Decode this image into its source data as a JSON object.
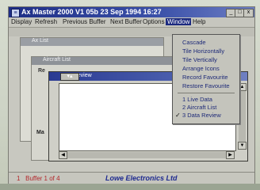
{
  "window": {
    "title": "Ax Master 2000 V1 05b 23 Sep 1994 16:27",
    "controls": [
      "_",
      "□",
      "x"
    ]
  },
  "menubar": {
    "items": [
      "Display",
      "Refresh",
      "Previous Buffer",
      "Next Buffer",
      "Options",
      "Window",
      "Help"
    ],
    "active": "Window"
  },
  "windows": {
    "back1_title": "Ax List",
    "back2_title": "Aircraft List",
    "back2_column": "Re",
    "back2_bottom": "Ma",
    "front_title": "Data Review"
  },
  "window_menu": {
    "items": [
      "Cascade",
      "Tile Horizontally",
      "Tile Vertically",
      "Arrange Icons",
      "Record Favourite",
      "Restore Favourite"
    ],
    "open_windows": [
      "1 Live Data",
      "2 Aircraft List",
      "3 Data Review"
    ],
    "checked": "3 Data Review"
  },
  "statusbar": {
    "index": "1",
    "buffer": "Buffer 1 of 4",
    "company": "Lowe Electronics Ltd"
  }
}
